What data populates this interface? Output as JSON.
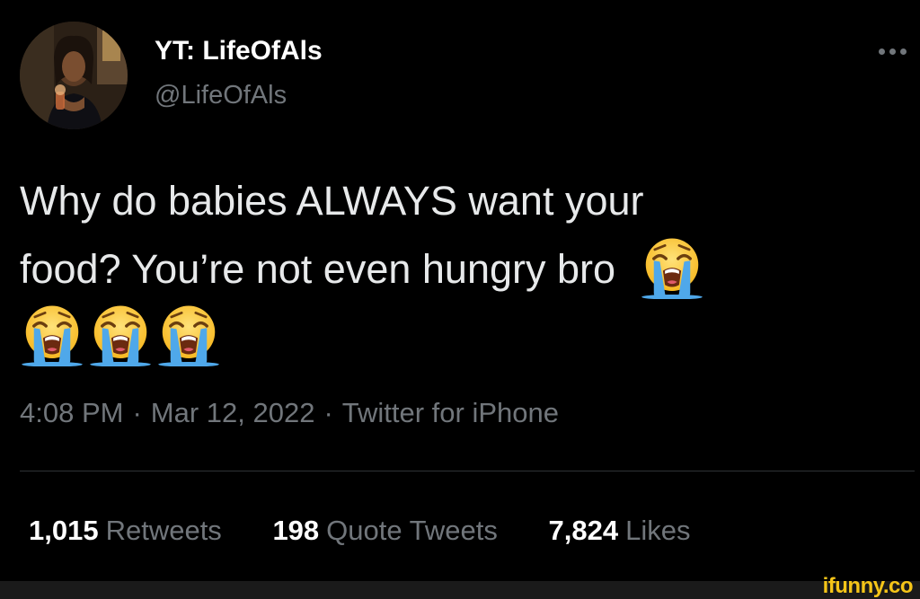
{
  "tweet": {
    "author": {
      "display_name": "YT: LifeOfAls",
      "handle": "@LifeOfAls"
    },
    "more_icon": "more-horizontal-icon",
    "text_lines": [
      "Why do babies ALWAYS want your",
      "food? You’re not even hungry bro"
    ],
    "emoji_name": "loudly-crying-face",
    "meta": {
      "time": "4:08 PM",
      "separator": "·",
      "date": "Mar 12, 2022",
      "source": "Twitter for iPhone"
    },
    "stats": {
      "retweets": {
        "count": "1,015",
        "label": "Retweets"
      },
      "quote_tweets": {
        "count": "198",
        "label": "Quote Tweets"
      },
      "likes": {
        "count": "7,824",
        "label": "Likes"
      }
    }
  },
  "watermark": "ifunny.co",
  "colors": {
    "background": "#000000",
    "primary_text": "#e7e9ea",
    "secondary_text": "#71767b",
    "divider": "#2f3336",
    "watermark": "#f5c518"
  }
}
